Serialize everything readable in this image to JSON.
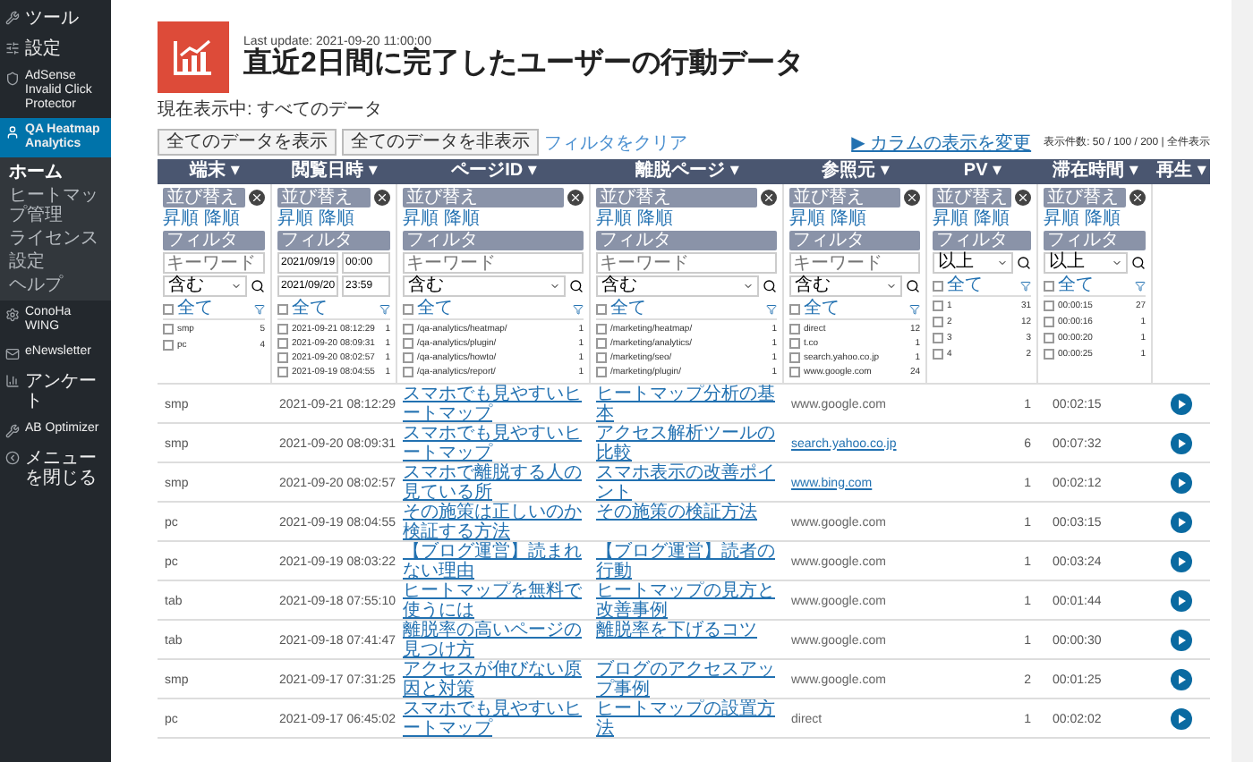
{
  "sidebar": {
    "items": [
      {
        "label": "ツール",
        "selected": false
      },
      {
        "label": "設定",
        "selected": false
      },
      {
        "label": "AdSense Invalid Click Protector",
        "selected": false
      },
      {
        "label": "QA Heatmap Analytics",
        "selected": true,
        "children": [
          {
            "label": "ホーム",
            "selected": true
          },
          {
            "label": "ヒートマップ管理",
            "selected": false
          },
          {
            "label": "ライセンス",
            "selected": false
          },
          {
            "label": "設定",
            "selected": false
          },
          {
            "label": "ヘルプ",
            "selected": false
          }
        ]
      },
      {
        "label": "ConoHa WING",
        "selected": false
      },
      {
        "label": "eNewsletter",
        "selected": false
      },
      {
        "label": "アンケート",
        "selected": false
      },
      {
        "label": "AB Optimizer",
        "selected": false
      },
      {
        "label": "メニューを閉じる",
        "selected": false
      }
    ]
  },
  "report": {
    "last_update": "Last update: 2021-09-20 11:00:00",
    "title": "直近2日間に完了したユーザーの行動データ",
    "status": "現在表示中: すべてのデータ",
    "buttons": [
      "全てのデータを表示",
      "全てのデータを非表示"
    ],
    "clear_link": "フィルタをクリア",
    "column_link": "▶ カラムの表示を変更",
    "page_size": "表示件数: 50 / 100 / 200 | 全件表示"
  },
  "table": {
    "columns": [
      {
        "label": "端末 ▾"
      },
      {
        "label": "閲覧日時 ▾"
      },
      {
        "label": "ページID ▾"
      },
      {
        "label": "離脱ページ ▾"
      },
      {
        "label": "参照元 ▾"
      },
      {
        "label": "PV ▾"
      },
      {
        "label": "滞在時間 ▾"
      },
      {
        "label": "再生 ▾"
      }
    ],
    "filters": [
      {
        "kind": "text",
        "sort_title": "並び替え",
        "sort_links": [
          "昇順",
          "降順"
        ],
        "filter_title": "フィルタ",
        "placeholder": "キーワード",
        "select": "含む",
        "all": "全て",
        "all_checked": false,
        "items": [
          {
            "label": "smp",
            "count": "5",
            "checked": false
          },
          {
            "label": "pc",
            "count": "4",
            "checked": false
          }
        ]
      },
      {
        "kind": "date",
        "sort_title": "並び替え",
        "sort_links": [
          "昇順",
          "降順"
        ],
        "filter_title": "フィルタ",
        "ranges": [
          {
            "date": "2021/09/19",
            "time": "00:00"
          },
          {
            "date": "2021/09/20",
            "time": "23:59"
          }
        ],
        "all": "全て",
        "all_checked": false,
        "items": [
          {
            "label": "2021-09-21 08:12:29",
            "count": "1",
            "checked": false
          },
          {
            "label": "2021-09-20 08:09:31",
            "count": "1",
            "checked": false
          },
          {
            "label": "2021-09-20 08:02:57",
            "count": "1",
            "checked": false
          },
          {
            "label": "2021-09-19 08:04:55",
            "count": "1",
            "checked": false
          }
        ]
      },
      {
        "kind": "text",
        "sort_title": "並び替え",
        "sort_links": [
          "昇順",
          "降順"
        ],
        "filter_title": "フィルタ",
        "placeholder": "キーワード",
        "select": "含む",
        "all": "全て",
        "all_checked": false,
        "items": [
          {
            "label": "/qa-analytics/heatmap/",
            "count": "1",
            "checked": false
          },
          {
            "label": "/qa-analytics/plugin/",
            "count": "1",
            "checked": false
          },
          {
            "label": "/qa-analytics/howto/",
            "count": "1",
            "checked": false
          },
          {
            "label": "/qa-analytics/report/",
            "count": "1",
            "checked": false
          }
        ]
      },
      {
        "kind": "text",
        "sort_title": "並び替え",
        "sort_links": [
          "昇順",
          "降順"
        ],
        "filter_title": "フィルタ",
        "placeholder": "キーワード",
        "select": "含む",
        "all": "全て",
        "all_checked": false,
        "items": [
          {
            "label": "/marketing/heatmap/",
            "count": "1",
            "checked": false
          },
          {
            "label": "/marketing/analytics/",
            "count": "1",
            "checked": false
          },
          {
            "label": "/marketing/seo/",
            "count": "1",
            "checked": false
          },
          {
            "label": "/marketing/plugin/",
            "count": "1",
            "checked": false
          }
        ]
      },
      {
        "kind": "text",
        "sort_title": "並び替え",
        "sort_links": [
          "昇順",
          "降順"
        ],
        "filter_title": "フィルタ",
        "placeholder": "キーワード",
        "select": "含む",
        "all": "全て",
        "all_checked": false,
        "items": [
          {
            "label": "direct",
            "count": "12",
            "checked": false
          },
          {
            "label": "t.co",
            "count": "1",
            "checked": false
          },
          {
            "label": "search.yahoo.co.jp",
            "count": "1",
            "checked": false
          },
          {
            "label": "www.google.com",
            "count": "24",
            "checked": false
          }
        ]
      },
      {
        "kind": "number",
        "sort_title": "並び替え",
        "sort_links": [
          "昇順",
          "降順"
        ],
        "filter_title": "フィルタ",
        "select": "以上",
        "all": "全て",
        "all_checked": false,
        "items": [
          {
            "label": "1",
            "count": "31",
            "checked": false
          },
          {
            "label": "2",
            "count": "12",
            "checked": false
          },
          {
            "label": "3",
            "count": "3",
            "checked": false
          },
          {
            "label": "4",
            "count": "2",
            "checked": false
          }
        ]
      },
      {
        "kind": "number",
        "sort_title": "並び替え",
        "sort_links": [
          "昇順",
          "降順"
        ],
        "filter_title": "フィルタ",
        "select": "以上",
        "all": "全て",
        "all_checked": false,
        "items": [
          {
            "label": "00:00:15",
            "count": "27",
            "checked": false
          },
          {
            "label": "00:00:16",
            "count": "1",
            "checked": false
          },
          {
            "label": "00:00:20",
            "count": "1",
            "checked": false
          },
          {
            "label": "00:00:25",
            "count": "1",
            "checked": false
          }
        ]
      }
    ],
    "rows": [
      {
        "device": "smp",
        "date": "2021-09-21 08:12:29",
        "page": "スマホでも見やすいヒートマップ",
        "exit": "ヒートマップ分析の基本",
        "referrer": "www.google.com",
        "linked": false,
        "pv": "1",
        "time": "00:02:15"
      },
      {
        "device": "smp",
        "date": "2021-09-20 08:09:31",
        "page": "スマホでも見やすいヒートマップ",
        "exit": "アクセス解析ツールの比較",
        "referrer": "search.yahoo.co.jp",
        "linked": true,
        "pv": "6",
        "time": "00:07:32"
      },
      {
        "device": "smp",
        "date": "2021-09-20 08:02:57",
        "page": "スマホで離脱する人の見ている所",
        "exit": "スマホ表示の改善ポイント",
        "referrer": "www.bing.com",
        "linked": true,
        "pv": "1",
        "time": "00:02:12"
      },
      {
        "device": "pc",
        "date": "2021-09-19 08:04:55",
        "page": "その施策は正しいのか検証する方法",
        "exit": "その施策の検証方法",
        "referrer": "www.google.com",
        "linked": false,
        "pv": "1",
        "time": "00:03:15"
      },
      {
        "device": "pc",
        "date": "2021-09-19 08:03:22",
        "page": "【ブログ運営】読まれない理由",
        "exit": "【ブログ運営】読者の行動",
        "referrer": "www.google.com",
        "linked": false,
        "pv": "1",
        "time": "00:03:24"
      },
      {
        "device": "tab",
        "date": "2021-09-18 07:55:10",
        "page": "ヒートマップを無料で使うには",
        "exit": "ヒートマップの見方と改善事例",
        "referrer": "www.google.com",
        "linked": false,
        "pv": "1",
        "time": "00:01:44"
      },
      {
        "device": "tab",
        "date": "2021-09-18 07:41:47",
        "page": "離脱率の高いページの見つけ方",
        "exit": "離脱率を下げるコツ",
        "referrer": "www.google.com",
        "linked": false,
        "pv": "1",
        "time": "00:00:30"
      },
      {
        "device": "smp",
        "date": "2021-09-17 07:31:25",
        "page": "アクセスが伸びない原因と対策",
        "exit": "ブログのアクセスアップ事例",
        "referrer": "www.google.com",
        "linked": false,
        "pv": "2",
        "time": "00:01:25"
      },
      {
        "device": "pc",
        "date": "2021-09-17 06:45:02",
        "page": "スマホでも見やすいヒートマップ",
        "exit": "ヒートマップの設置方法",
        "referrer": "direct",
        "linked": false,
        "pv": "1",
        "time": "00:02:02"
      }
    ]
  }
}
